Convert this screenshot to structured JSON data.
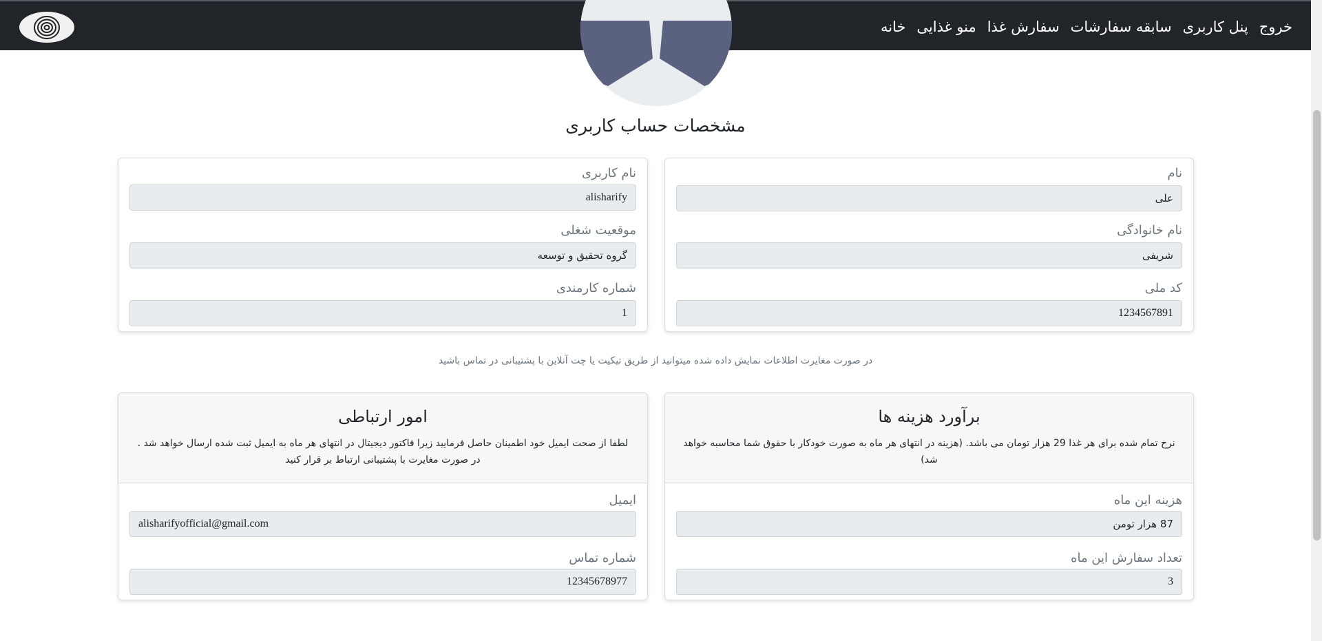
{
  "nav": {
    "links": [
      "خانه",
      "منو غذایی",
      "سفارش غذا",
      "سابقه سفارشات",
      "پنل کاربری",
      "خروج"
    ]
  },
  "page_title": "مشخصات حساب کاربری",
  "profile": {
    "first_name": {
      "label": "نام",
      "value": "علی"
    },
    "last_name": {
      "label": "نام خانوادگی",
      "value": "شریفی"
    },
    "national_code": {
      "label": "کد ملی",
      "value": "1234567891"
    },
    "username": {
      "label": "نام کاربری",
      "value": "alisharify"
    },
    "job_position": {
      "label": "موقعیت شغلی",
      "value": "گروه تحقیق و توسعه"
    },
    "employee_number": {
      "label": "شماره کارمندی",
      "value": "1"
    }
  },
  "notice": "در صورت مغایرت اطلاعات نمایش داده شده میتوانید از طریق تیکیت یا چت آنلاین با پشتیبانی در تماس باشید",
  "costs": {
    "title": "برآورد هزینه ها",
    "description": "نرخ تمام شده برای هر غذا 29 هزار تومان می باشد. (هزینه در انتهای هر ماه به صورت خودکار با حقوق شما محاسبه خواهد شد)",
    "month_cost": {
      "label": "هزینه این ماه",
      "value": "87 هزار تومن"
    },
    "order_count": {
      "label": "تعداد سفارش این ماه",
      "value": "3"
    }
  },
  "contact": {
    "title": "امور ارتباطی",
    "description": "لطفا از صحت ایمیل خود اطمینان حاصل فرمایید زیرا فاکتور دیجیتال در انتهای هر ماه به ایمیل ثبت شده ارسال خواهد شد . در صورت مغایرت با پشتیبانی ارتباط بر قرار کنید",
    "email": {
      "label": "ایمیل",
      "value": "alisharifyofficial@gmail.com"
    },
    "phone": {
      "label": "شماره تماس",
      "value": "12345678977"
    }
  },
  "colors": {
    "navbar": "#212529",
    "input_bg": "#e9ecef",
    "label": "#6c757d"
  }
}
